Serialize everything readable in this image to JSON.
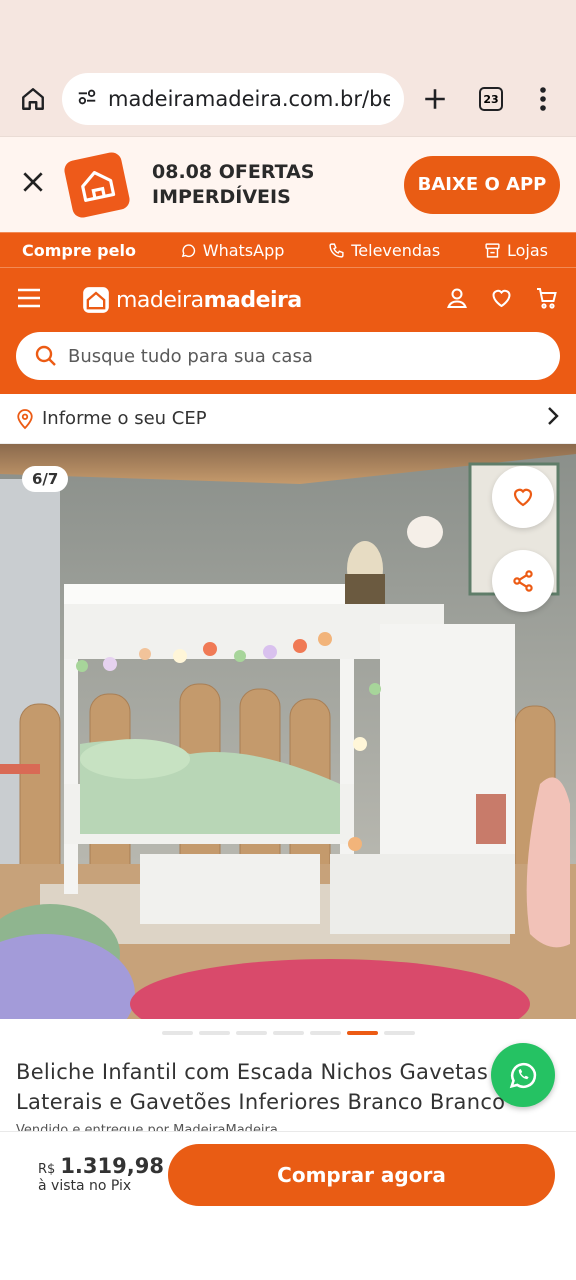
{
  "browser": {
    "url": "madeiramadeira.com.br/be",
    "tab_count": "23"
  },
  "app_banner": {
    "promo_text": "08.08 OFERTAS IMPERDÍVEIS",
    "button_label": "BAIXE O APP"
  },
  "contact_bar": {
    "lead": "Compre pelo",
    "whatsapp": "WhatsApp",
    "televendas": "Televendas",
    "lojas": "Lojas"
  },
  "header": {
    "brand_light": "madeira",
    "brand_bold": "madeira",
    "search_placeholder": "Busque tudo para sua casa"
  },
  "cep": {
    "label": "Informe o seu CEP"
  },
  "gallery": {
    "counter": "6/7",
    "current_index": 6,
    "total": 7
  },
  "product": {
    "title": "Beliche Infantil com Escada Nichos Gavetas Laterais e Gavetões Inferiores Branco Branco",
    "sold_by": "Vendido e entregue por MadeiraMadeira"
  },
  "buy_bar": {
    "currency": "R$",
    "price": "1.319,98",
    "price_note": "à vista no Pix",
    "button_label": "Comprar agora"
  },
  "colors": {
    "brand_orange": "#ec5b14",
    "whatsapp_green": "#25c263",
    "browser_bg": "#f5e6e0"
  }
}
